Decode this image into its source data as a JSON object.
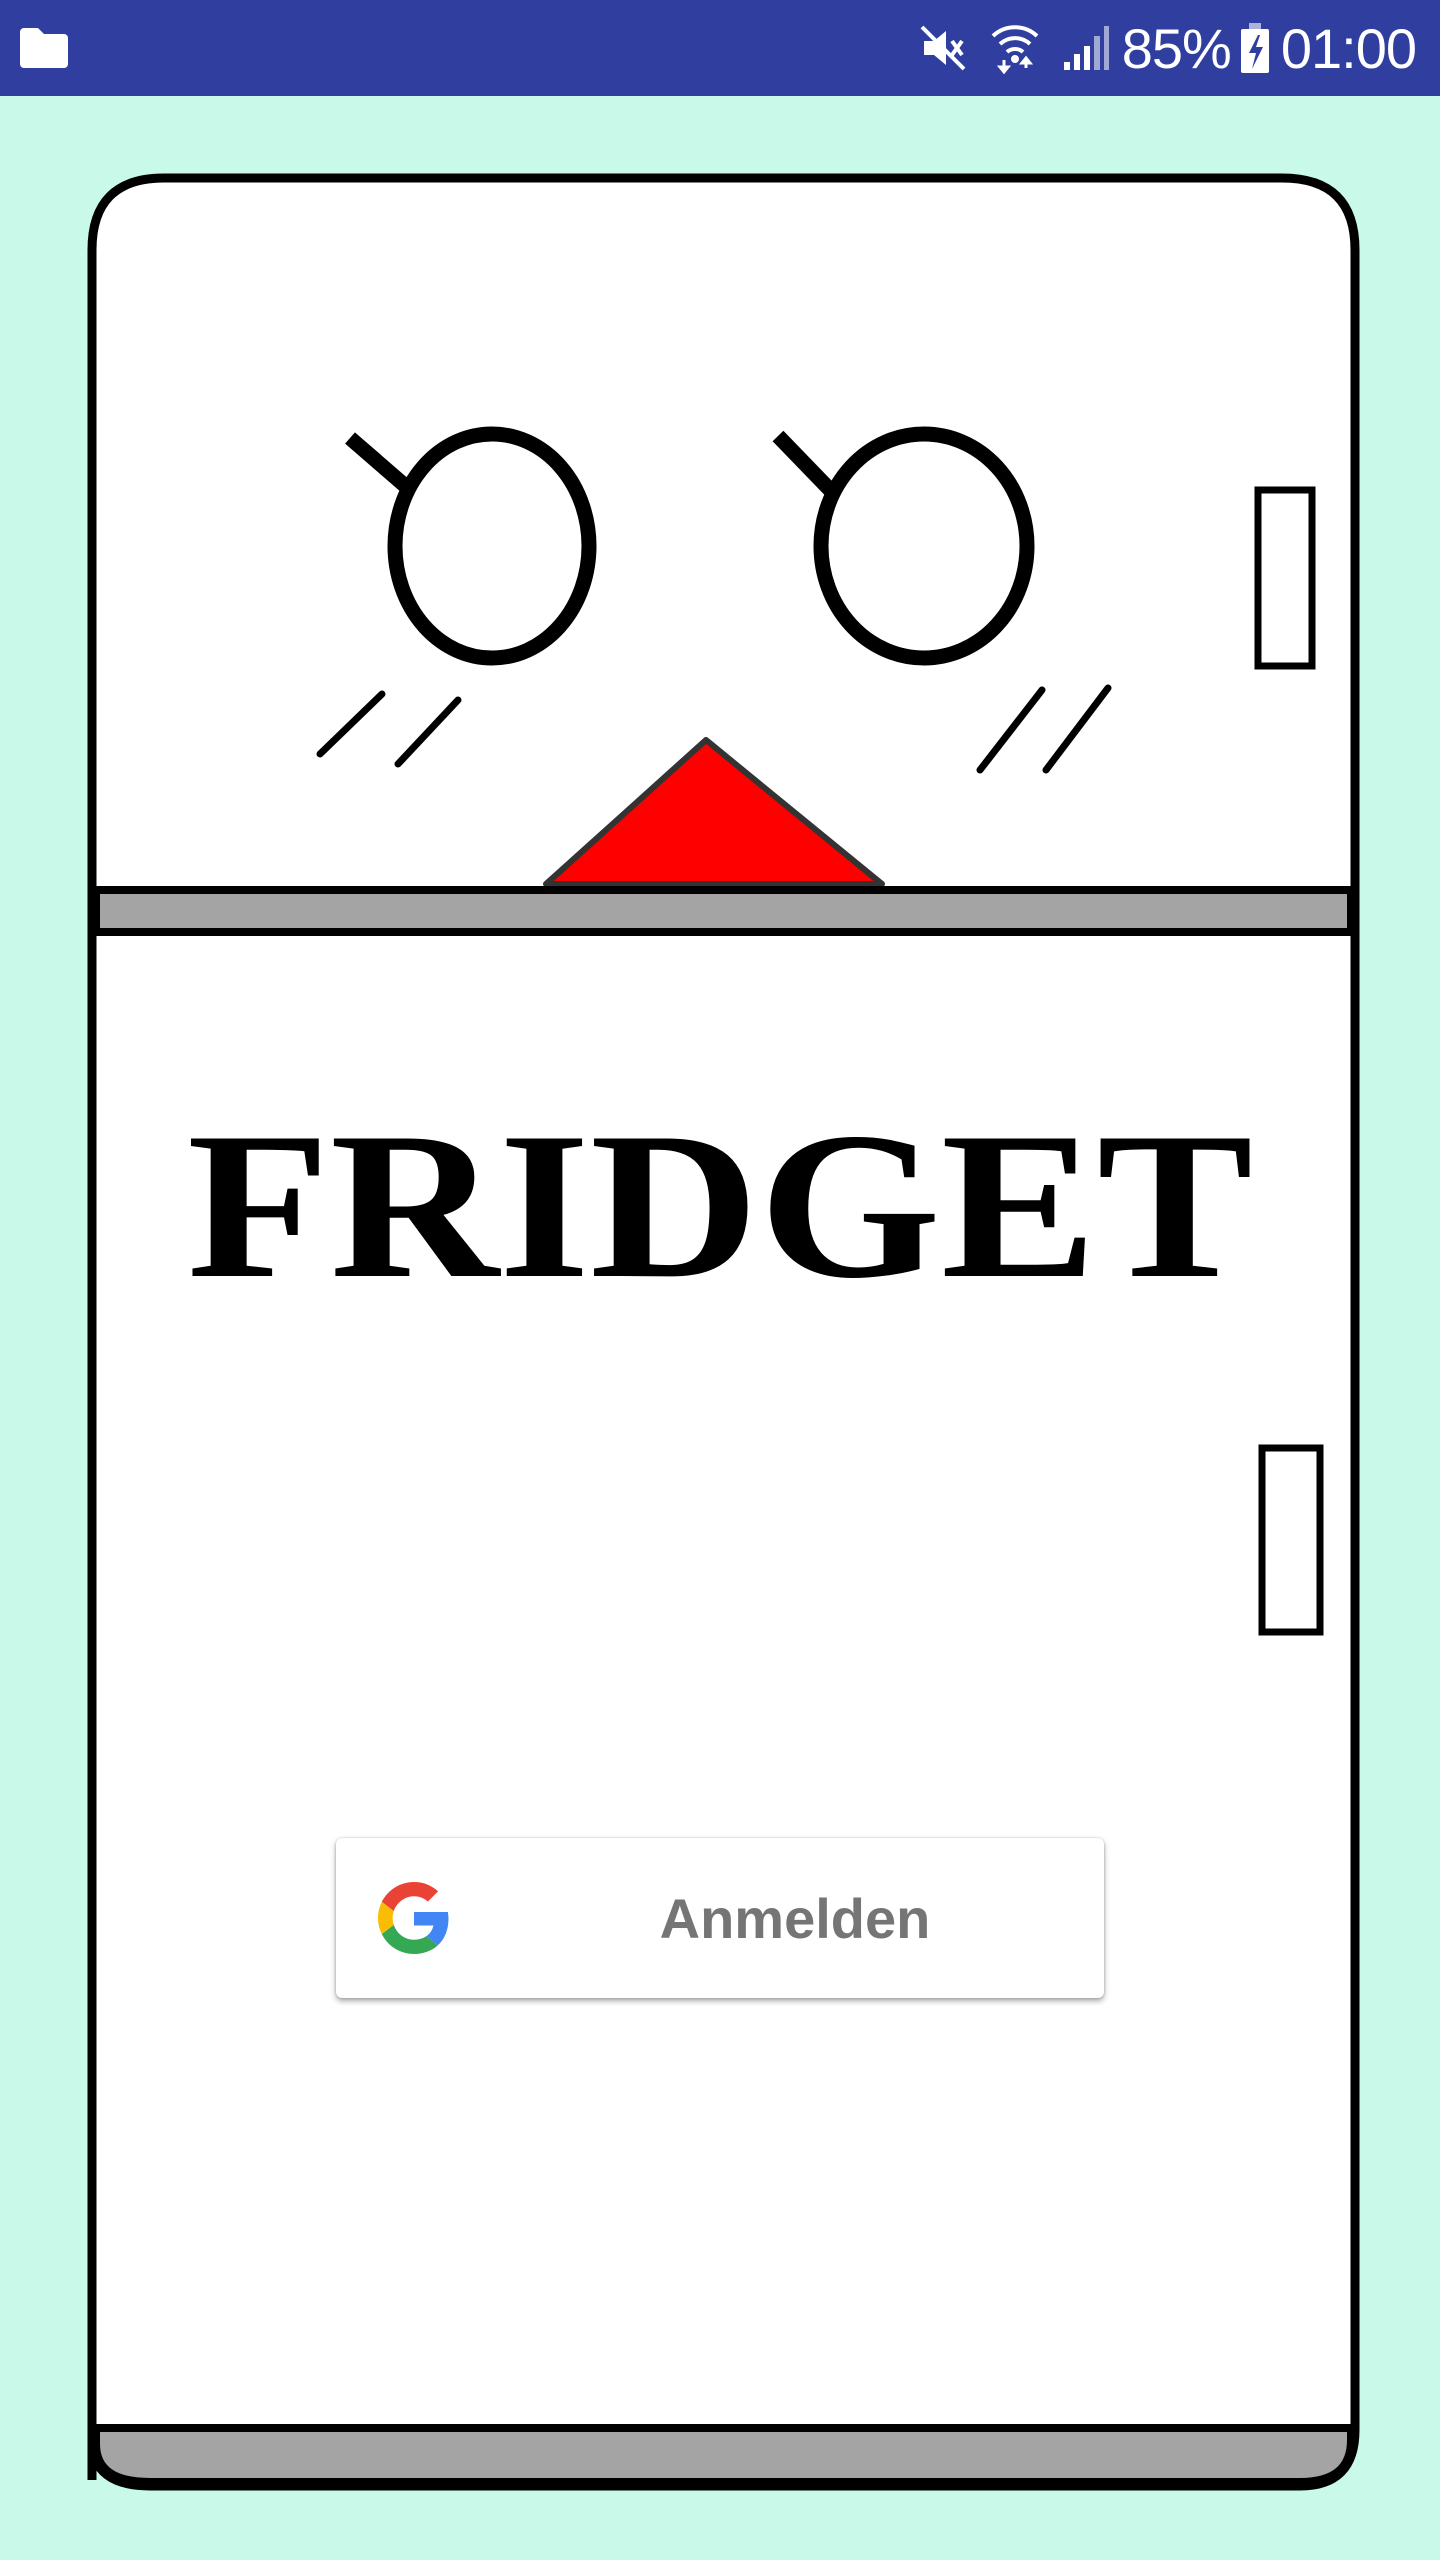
{
  "status_bar": {
    "battery_percent": "85%",
    "time": "01:00",
    "icons": [
      "folder-icon",
      "mute-icon",
      "wifi-icon",
      "signal-icon",
      "battery-charging-icon"
    ],
    "background_color": "#303f9f"
  },
  "app": {
    "logo_text": "FRIDGET",
    "background_color": "#c9fae9",
    "accent_color": "#ff0000"
  },
  "login": {
    "button_label": "Anmelden",
    "button_icon": "google-g-icon"
  }
}
